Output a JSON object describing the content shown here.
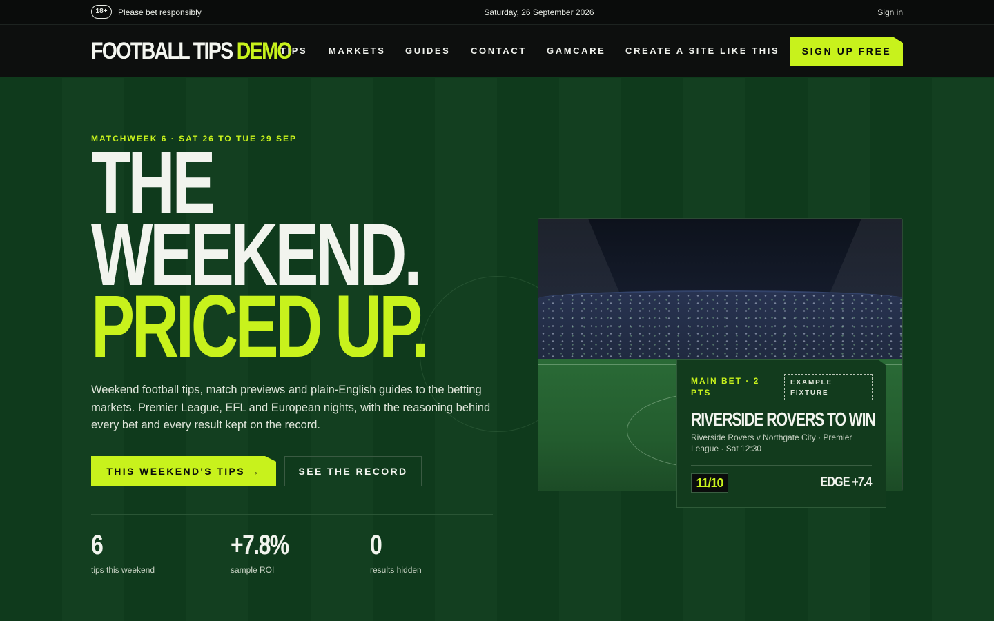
{
  "topbar": {
    "age_badge": "18+",
    "responsibly": "Please bet responsibly",
    "date": "Saturday, 26 September 2026",
    "signin": "Sign in"
  },
  "header": {
    "logo_main": "FOOTBALL TIPS",
    "logo_accent": "DEMO",
    "nav": [
      "TIPS",
      "MARKETS",
      "GUIDES",
      "CONTACT",
      "GAMCARE",
      "CREATE A SITE LIKE THIS"
    ],
    "signup": "SIGN UP FREE"
  },
  "hero": {
    "eyebrow": "MATCHWEEK 6 · SAT 26 TO TUE 29 SEP",
    "headline": [
      "THE",
      "WEEKEND.",
      "PRICED UP."
    ],
    "lede": "Weekend football tips, match previews and plain-English guides to the betting markets. Premier League, EFL and European nights, with the reasoning behind every bet and every result kept on the record.",
    "primary_cta": "THIS WEEKEND'S TIPS →",
    "secondary_cta": "SEE THE RECORD",
    "stats": [
      {
        "value": "6",
        "label": "tips this weekend"
      },
      {
        "value": "+7.8%",
        "label": "sample ROI"
      },
      {
        "value": "0",
        "label": "results hidden"
      }
    ]
  },
  "bet_card": {
    "tag": "MAIN BET · 2 PTS",
    "example": "EXAMPLE FIXTURE",
    "title": "RIVERSIDE ROVERS TO WIN",
    "fixture": "Riverside Rovers v Northgate City · Premier League · Sat 12:30",
    "odds": "11/10",
    "edge": "EDGE +7.4"
  },
  "colors": {
    "accent": "#c8f21c",
    "background": "#0f3a1c",
    "topbar": "#0a0c0b"
  }
}
